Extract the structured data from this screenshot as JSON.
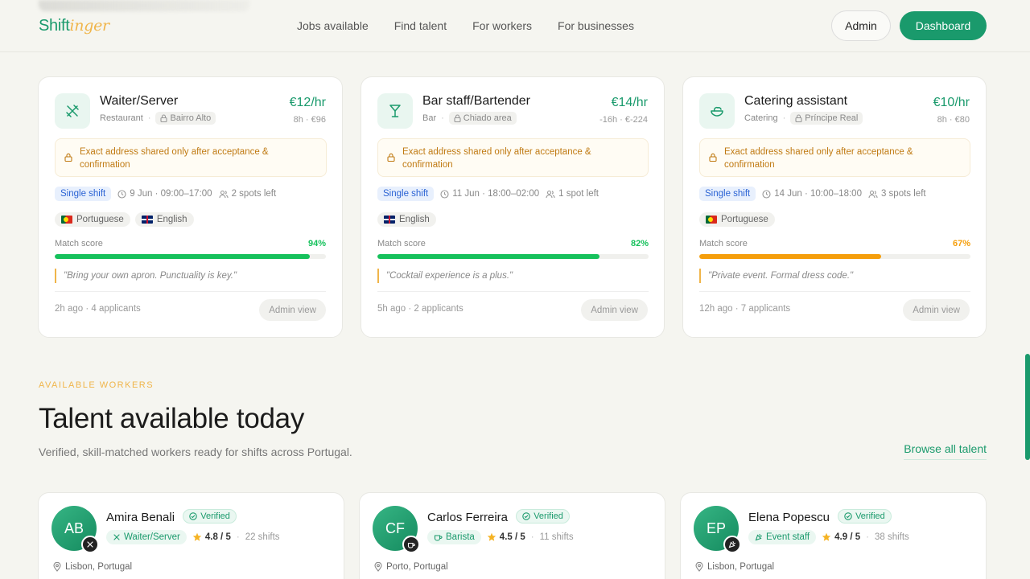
{
  "header": {
    "logo_main": "Shift",
    "logo_accent": "inger",
    "nav": [
      "Jobs available",
      "Find talent",
      "For workers",
      "For businesses"
    ],
    "admin_label": "Admin",
    "dashboard_label": "Dashboard"
  },
  "jobs": [
    {
      "title": "Waiter/Server",
      "category": "Restaurant",
      "area": "Bairro Alto",
      "rate": "€12/hr",
      "hours_total": "8h · €96",
      "address_note": "Exact address shared only after acceptance & confirmation",
      "shift_type": "Single shift",
      "date_time": "9 Jun · 09:00–17:00",
      "spots": "2 spots left",
      "languages": [
        {
          "flag": "pt",
          "name": "Portuguese"
        },
        {
          "flag": "gb",
          "name": "English"
        }
      ],
      "match_label": "Match score",
      "match": 94,
      "match_text": "94%",
      "match_color": "#16c15c",
      "note": "\"Bring your own apron. Punctuality is key.\"",
      "posted": "2h ago · 4 applicants",
      "admin_view": "Admin view",
      "icon": "utensils-icon"
    },
    {
      "title": "Bar staff/Bartender",
      "category": "Bar",
      "area": "Chiado area",
      "rate": "€14/hr",
      "hours_total": "-16h · €-224",
      "address_note": "Exact address shared only after acceptance & confirmation",
      "shift_type": "Single shift",
      "date_time": "11 Jun · 18:00–02:00",
      "spots": "1 spot left",
      "languages": [
        {
          "flag": "gb",
          "name": "English"
        }
      ],
      "match_label": "Match score",
      "match": 82,
      "match_text": "82%",
      "match_color": "#16c15c",
      "note": "\"Cocktail experience is a plus.\"",
      "posted": "5h ago · 2 applicants",
      "admin_view": "Admin view",
      "icon": "cocktail-icon"
    },
    {
      "title": "Catering assistant",
      "category": "Catering",
      "area": "Príncipe Real",
      "rate": "€10/hr",
      "hours_total": "8h · €80",
      "address_note": "Exact address shared only after acceptance & confirmation",
      "shift_type": "Single shift",
      "date_time": "14 Jun · 10:00–18:00",
      "spots": "3 spots left",
      "languages": [
        {
          "flag": "pt",
          "name": "Portuguese"
        }
      ],
      "match_label": "Match score",
      "match": 67,
      "match_text": "67%",
      "match_color": "#f59e0b",
      "note": "\"Private event. Formal dress code.\"",
      "posted": "12h ago · 7 applicants",
      "admin_view": "Admin view",
      "icon": "salad-bowl-icon"
    }
  ],
  "section": {
    "eyebrow": "AVAILABLE WORKERS",
    "title": "Talent available today",
    "subtitle": "Verified, skill-matched workers ready for shifts across Portugal.",
    "browse_label": "Browse all talent"
  },
  "workers": [
    {
      "initials": "AB",
      "name": "Amira Benali",
      "verified": "Verified",
      "role": "Waiter/Server",
      "rating": "4.8 / 5",
      "shifts": "22 shifts",
      "location": "Lisbon, Portugal",
      "badge_icon": "utensils-icon"
    },
    {
      "initials": "CF",
      "name": "Carlos Ferreira",
      "verified": "Verified",
      "role": "Barista",
      "rating": "4.5 / 5",
      "shifts": "11 shifts",
      "location": "Porto, Portugal",
      "badge_icon": "coffee-icon"
    },
    {
      "initials": "EP",
      "name": "Elena Popescu",
      "verified": "Verified",
      "role": "Event staff",
      "rating": "4.9 / 5",
      "shifts": "38 shifts",
      "location": "Lisbon, Portugal",
      "badge_icon": "party-icon"
    }
  ],
  "colors": {
    "brand": "#1a9a6c",
    "accent": "#f0b54a"
  }
}
